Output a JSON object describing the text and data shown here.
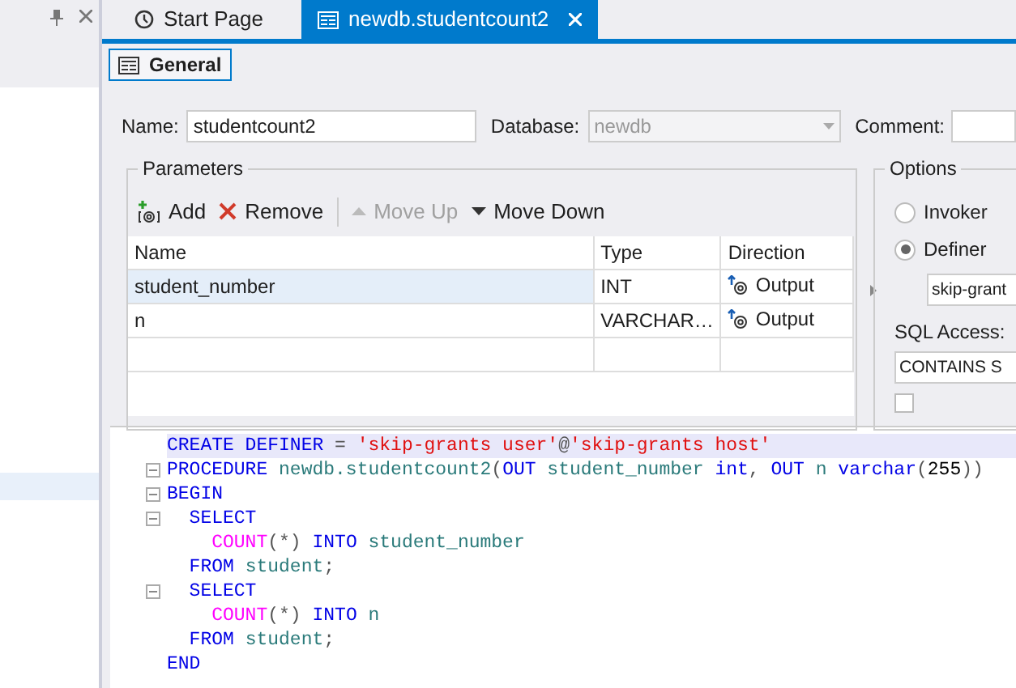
{
  "tabs": [
    {
      "label": "Start Page",
      "kind": "start",
      "selected": false
    },
    {
      "label": "newdb.studentcount2",
      "kind": "routine",
      "selected": true,
      "closable": true
    }
  ],
  "section_button": {
    "label": "General",
    "selected": true
  },
  "form": {
    "name_label": "Name:",
    "name_value": "studentcount2",
    "database_label": "Database:",
    "database_value": "newdb",
    "database_disabled": true,
    "comment_label": "Comment:"
  },
  "parameters": {
    "title": "Parameters",
    "toolbar": [
      {
        "kind": "add",
        "label": "Add",
        "disabled": false
      },
      {
        "kind": "remove",
        "label": "Remove",
        "disabled": false
      },
      {
        "kind": "up",
        "label": "Move Up",
        "disabled": true
      },
      {
        "kind": "down",
        "label": "Move Down",
        "disabled": false
      }
    ],
    "columns": [
      "Name",
      "Type",
      "Direction"
    ],
    "rows": [
      {
        "name": "student_number",
        "type": "INT",
        "direction": "Output",
        "selected": true
      },
      {
        "name": "n",
        "type": "VARCHAR…",
        "direction": "Output",
        "selected": false
      }
    ]
  },
  "options": {
    "title": "Options",
    "radios": [
      {
        "label": "Invoker",
        "selected": false
      },
      {
        "label": "Definer",
        "selected": true
      }
    ],
    "definer_value": "skip-grant",
    "sql_access_label": "SQL Access:",
    "sql_access_value": "CONTAINS S",
    "deterministic_checked": false
  },
  "editor": {
    "lines": [
      {
        "fold": false,
        "current": true,
        "tokens": [
          {
            "kind": "kw",
            "text": "CREATE DEFINER"
          },
          {
            "kind": "plain",
            "text": " = "
          },
          {
            "kind": "str",
            "text": "'skip-grants user'"
          },
          {
            "kind": "plain",
            "text": "@"
          },
          {
            "kind": "str",
            "text": "'skip-grants host'"
          }
        ]
      },
      {
        "fold": true,
        "current": false,
        "tokens": [
          {
            "kind": "kw",
            "text": "PROCEDURE"
          },
          {
            "kind": "id",
            "text": " newdb.studentcount2"
          },
          {
            "kind": "plain",
            "text": "("
          },
          {
            "kind": "kw",
            "text": "OUT"
          },
          {
            "kind": "id",
            "text": " student_number "
          },
          {
            "kind": "kw",
            "text": "int"
          },
          {
            "kind": "plain",
            "text": ", "
          },
          {
            "kind": "kw",
            "text": "OUT"
          },
          {
            "kind": "id",
            "text": " n "
          },
          {
            "kind": "kw",
            "text": "varchar"
          },
          {
            "kind": "plain",
            "text": "("
          },
          {
            "kind": "num",
            "text": "255"
          },
          {
            "kind": "plain",
            "text": "))"
          }
        ]
      },
      {
        "fold": true,
        "current": false,
        "tokens": [
          {
            "kind": "kw",
            "text": "BEGIN"
          }
        ]
      },
      {
        "fold": true,
        "current": false,
        "tokens": [
          {
            "kind": "kw",
            "text": "  SELECT"
          }
        ]
      },
      {
        "fold": false,
        "current": false,
        "tokens": [
          {
            "kind": "fn",
            "text": "    COUNT"
          },
          {
            "kind": "plain",
            "text": "(*) "
          },
          {
            "kind": "kw",
            "text": "INTO"
          },
          {
            "kind": "id",
            "text": " student_number"
          }
        ]
      },
      {
        "fold": false,
        "current": false,
        "tokens": [
          {
            "kind": "kw",
            "text": "  FROM"
          },
          {
            "kind": "id",
            "text": " student"
          },
          {
            "kind": "plain",
            "text": ";"
          }
        ]
      },
      {
        "fold": true,
        "current": false,
        "tokens": [
          {
            "kind": "kw",
            "text": "  SELECT"
          }
        ]
      },
      {
        "fold": false,
        "current": false,
        "tokens": [
          {
            "kind": "fn",
            "text": "    COUNT"
          },
          {
            "kind": "plain",
            "text": "(*) "
          },
          {
            "kind": "kw",
            "text": "INTO"
          },
          {
            "kind": "id",
            "text": " n"
          }
        ]
      },
      {
        "fold": false,
        "current": false,
        "tokens": [
          {
            "kind": "kw",
            "text": "  FROM"
          },
          {
            "kind": "id",
            "text": " student"
          },
          {
            "kind": "plain",
            "text": ";"
          }
        ]
      },
      {
        "fold": false,
        "current": false,
        "tokens": [
          {
            "kind": "kw",
            "text": "END"
          }
        ]
      }
    ]
  }
}
